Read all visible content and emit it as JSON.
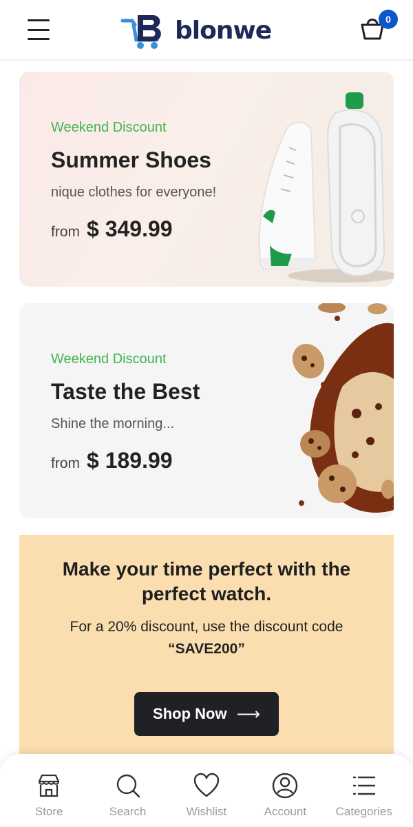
{
  "header": {
    "brand": "blonwe",
    "cart_count": "0"
  },
  "promos": [
    {
      "tag": "Weekend Discount",
      "title": "Summer Shoes",
      "subtitle": "nique clothes for everyone!",
      "from_label": "from",
      "price": "$ 349.99",
      "image_icon": "sneaker-image"
    },
    {
      "tag": "Weekend Discount",
      "title": "Taste the Best",
      "subtitle": "Shine the morning...",
      "from_label": "from",
      "price": "$ 189.99",
      "image_icon": "chocolate-cookie-image"
    }
  ],
  "watch_banner": {
    "title": "Make your time perfect with the perfect watch.",
    "desc_prefix": "For a 20% discount, use the discount code",
    "code": "“SAVE200”",
    "button_label": "Shop Now",
    "button_icon": "arrow-right-icon"
  },
  "bottom_nav": [
    {
      "label": "Store",
      "icon": "store-icon"
    },
    {
      "label": "Search",
      "icon": "search-icon"
    },
    {
      "label": "Wishlist",
      "icon": "heart-icon"
    },
    {
      "label": "Account",
      "icon": "account-icon"
    },
    {
      "label": "Categories",
      "icon": "list-icon"
    }
  ],
  "colors": {
    "accent_green": "#3fb44e",
    "brand_navy": "#1d2a59",
    "badge_blue": "#0b57c9",
    "banner_bg": "#fbdeaf",
    "button_dark": "#1f2125"
  }
}
